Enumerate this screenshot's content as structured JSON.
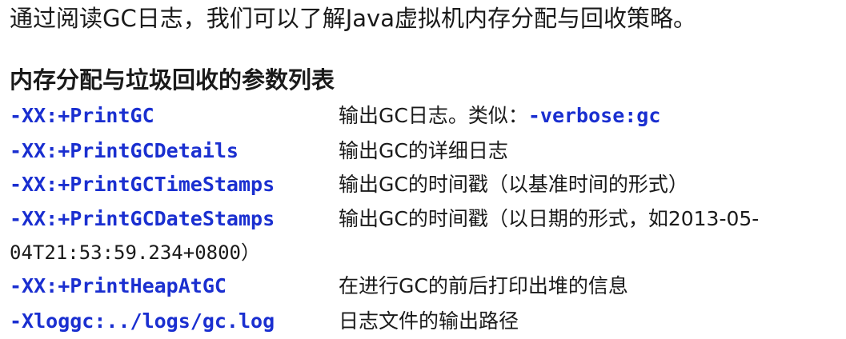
{
  "intro": "通过阅读GC日志，我们可以了解Java虚拟机内存分配与回收策略。",
  "heading": "内存分配与垃圾回收的参数列表",
  "params": [
    {
      "option": "-XX:+PrintGC",
      "desc": "输出GC日志。类似：",
      "desc_code": "-verbose:gc"
    },
    {
      "option": "-XX:+PrintGCDetails",
      "desc": "输出GC的详细日志"
    },
    {
      "option": "-XX:+PrintGCTimeStamps",
      "desc": "输出GC的时间戳（以基准时间的形式）"
    },
    {
      "option": "-XX:+PrintGCDateStamps",
      "desc": "输出GC的时间戳（以日期的形式，如2013-05-",
      "desc_cont": "04T21:53:59.234+0800）"
    },
    {
      "option": "-XX:+PrintHeapAtGC",
      "desc": "在进行GC的前后打印出堆的信息"
    },
    {
      "option": "-Xloggc:../logs/gc.log",
      "desc": "日志文件的输出路径"
    }
  ]
}
